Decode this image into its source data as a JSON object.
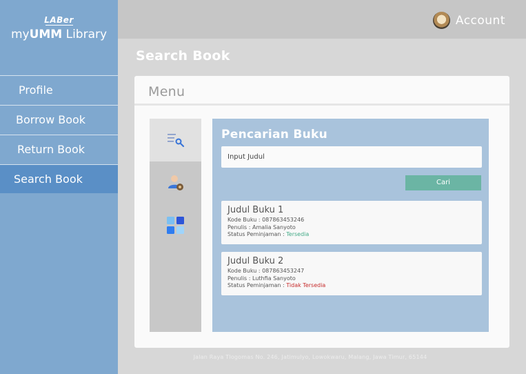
{
  "brand": {
    "mark": "LABer",
    "name_prefix": "my",
    "name_bold": "UMM",
    "name_suffix": " Library"
  },
  "nav": [
    {
      "label": "Profile"
    },
    {
      "label": "Borrow Book"
    },
    {
      "label": "Return Book"
    },
    {
      "label": "Search Book",
      "active": true
    }
  ],
  "topbar": {
    "account_label": "Account"
  },
  "page": {
    "title": "Search Book"
  },
  "card": {
    "header": "Menu"
  },
  "rail": [
    {
      "icon": "search-list-icon",
      "active": true
    },
    {
      "icon": "user-settings-icon"
    },
    {
      "icon": "grid-apps-icon"
    }
  ],
  "search": {
    "title": "Pencarian Buku",
    "placeholder": "Input Judul",
    "button_label": "Cari"
  },
  "results": [
    {
      "title": "Judul Buku 1",
      "code": "Kode Buku : 087863453246",
      "author": "Penulis : Amalia Sanyoto",
      "status_label": "Status Peminjaman : ",
      "status": "Tersedia",
      "status_color": "#41a986"
    },
    {
      "title": "Judul Buku 2",
      "code": "Kode Buku : 087863453247",
      "author": "Penulis : Luthfia Sanyoto",
      "status_label": "Status Peminjaman : ",
      "status": "Tidak Tersedia",
      "status_color": "#c62a2a"
    }
  ],
  "footer": {
    "address": "Jalan Raya Tlogomas No. 246, Jatimulyo, Lowokwaru, Malang, Jawa Timur, 65144"
  },
  "colors": {
    "sidebar": "#7fa8cf",
    "active_nav": "#5a8fc6",
    "panel": "#a9c3dc",
    "button": "#6bb5a4"
  }
}
